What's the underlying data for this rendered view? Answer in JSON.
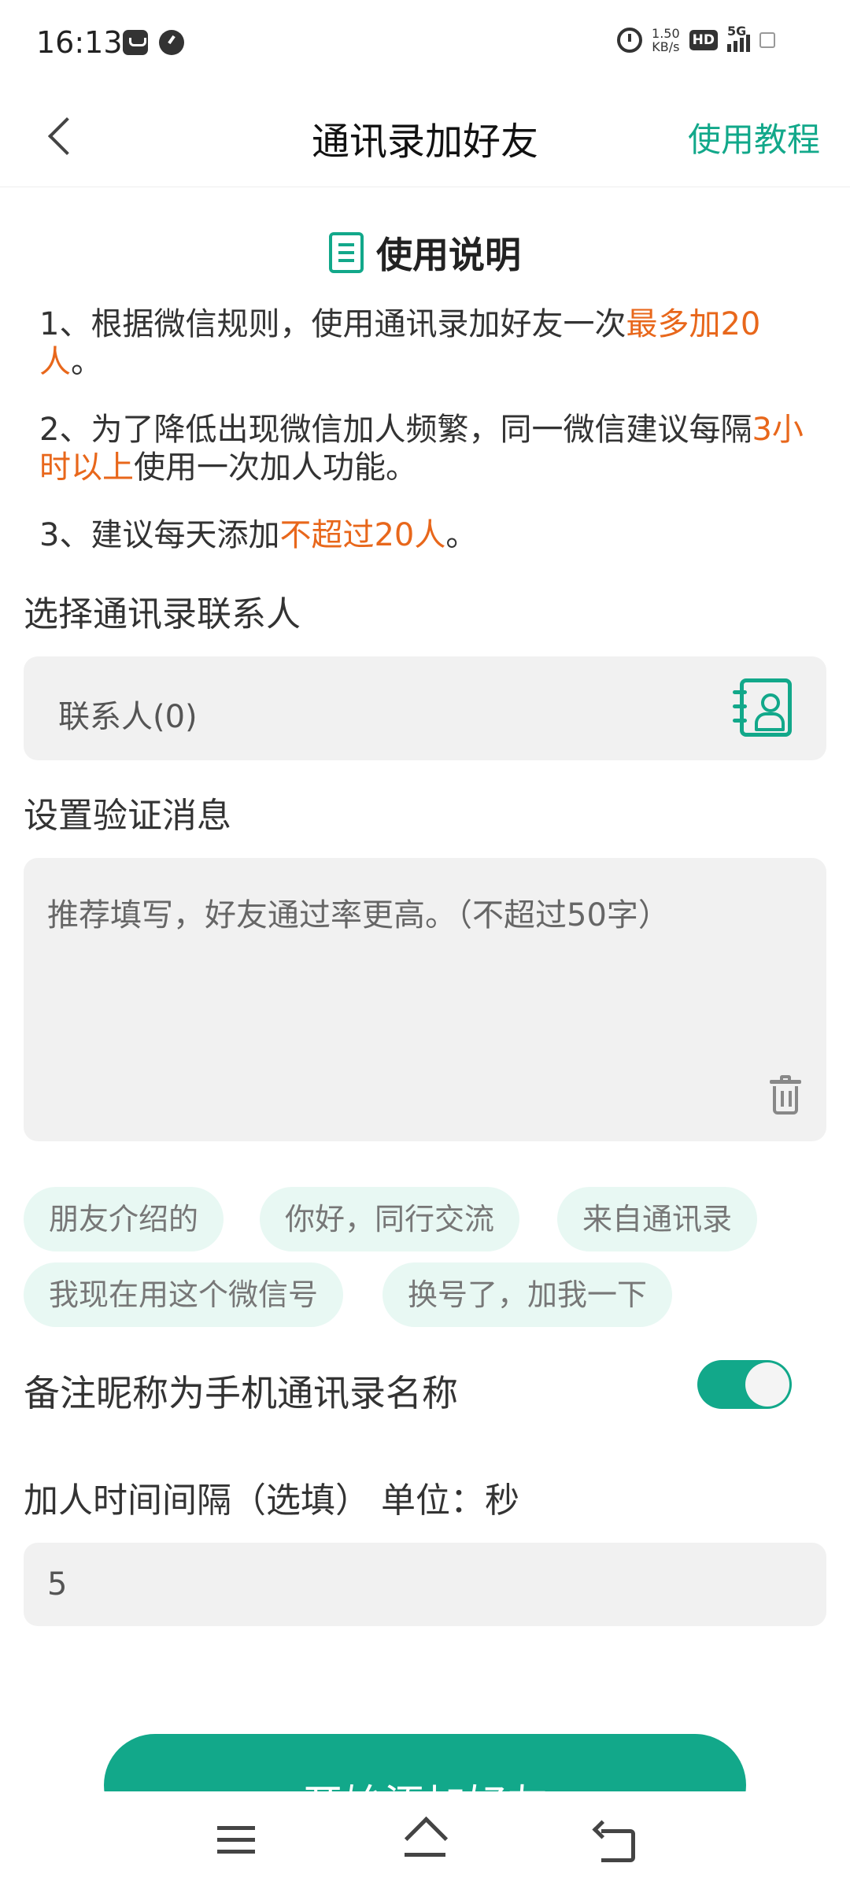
{
  "status_bar": {
    "time": "16:13",
    "net_speed_value": "1.50",
    "net_speed_unit": "KB/s",
    "hd": "HD",
    "network": "5G"
  },
  "header": {
    "title": "通讯录加好友",
    "tutorial_link": "使用教程"
  },
  "instructions": {
    "title": "使用说明",
    "rule1": {
      "pre": "1、根据微信规则，使用通讯录加好友一次",
      "hl": "最多加20人",
      "post": "。"
    },
    "rule2": {
      "pre": "2、为了降低出现微信加人频繁，同一微信建议每隔",
      "hl": "3小时以上",
      "post": "使用一次加人功能。"
    },
    "rule3": {
      "pre": "3、建议每天添加",
      "hl": "不超过20人",
      "post": "。"
    }
  },
  "contacts": {
    "label": "选择通讯录联系人",
    "field": "联系人(0)"
  },
  "message": {
    "label": "设置验证消息",
    "placeholder": "推荐填写，好友通过率更高。（不超过50字）"
  },
  "quick_messages": [
    "朋友介绍的",
    "你好，同行交流",
    "来自通讯录",
    "我现在用这个微信号",
    "换号了，加我一下"
  ],
  "remark": {
    "label": "备注昵称为手机通讯录名称",
    "toggle_on": true
  },
  "interval": {
    "label": "加人时间间隔（选填） 单位：秒",
    "value": "5"
  },
  "start_button": "开始添加好友",
  "colors": {
    "accent": "#12a88a",
    "highlight": "#e8671b",
    "chip_bg": "#e8f8f3",
    "field_bg": "#f1f1f1"
  }
}
